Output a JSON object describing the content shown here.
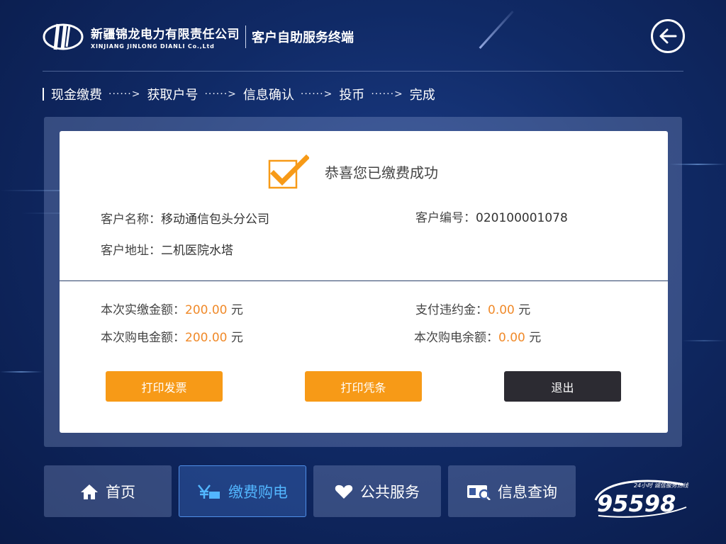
{
  "header": {
    "company_cn": "新疆锦龙电力有限责任公司",
    "company_en": "XINJIANG JINLONG DIANLI Co.,Ltd",
    "terminal_title": "客户自助服务终端",
    "back_icon": "back-arrow-icon"
  },
  "breadcrumb": {
    "steps": [
      "现金缴费",
      "获取户号",
      "信息确认",
      "投币",
      "完成"
    ],
    "separator": "······>"
  },
  "result": {
    "success_message": "恭喜您已缴费成功",
    "customer_name_label": "客户名称：",
    "customer_name": "移动通信包头分公司",
    "customer_no_label": "客户编号：",
    "customer_no": "020100001078",
    "customer_addr_label": "客户地址：",
    "customer_addr": "二机医院水塔",
    "paid_amount_label": "本次实缴金额：",
    "paid_amount": "200.00",
    "penalty_label": "支付违约金：",
    "penalty": "0.00",
    "purchase_amount_label": "本次购电金额：",
    "purchase_amount": "200.00",
    "balance_label": "本次购电余额：",
    "balance": "0.00",
    "unit": "元"
  },
  "actions": {
    "print_invoice": "打印发票",
    "print_receipt": "打印凭条",
    "exit": "退出"
  },
  "nav": [
    {
      "label": "首页",
      "icon": "home-icon",
      "active": false
    },
    {
      "label": "缴费购电",
      "icon": "yen-card-icon",
      "active": true
    },
    {
      "label": "公共服务",
      "icon": "heart-hand-icon",
      "active": false
    },
    {
      "label": "信息查询",
      "icon": "id-card-search-icon",
      "active": false
    }
  ],
  "hotline": {
    "number": "95598",
    "tagline": "24小时 诚信服务热线"
  },
  "colors": {
    "accent_orange": "#f79a17",
    "money_orange": "#f08a2a",
    "active_nav": "#52b6ff",
    "exit_button": "#2c2b32"
  }
}
